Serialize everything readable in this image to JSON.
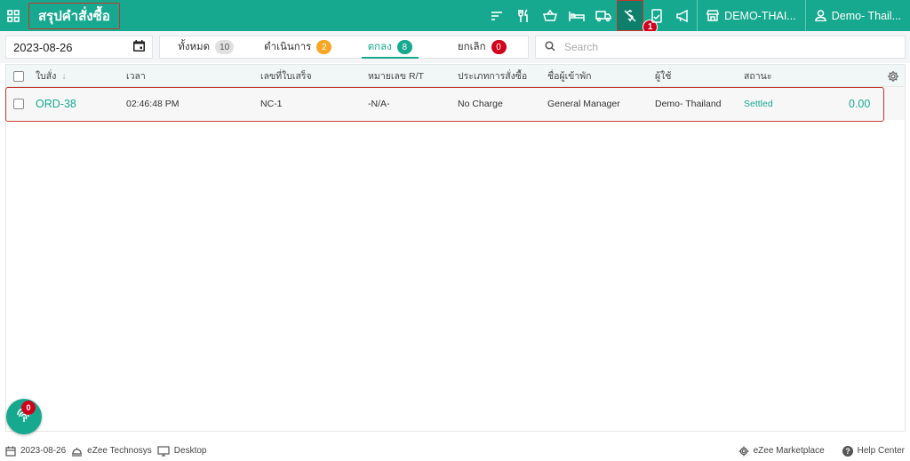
{
  "header": {
    "title": "สรุปคำสั่งซื้อ",
    "property": "DEMO-THAI...",
    "user": "Demo- Thail...",
    "notification_count": "1"
  },
  "filters": {
    "date": "2023-08-26",
    "search_placeholder": "Search",
    "tabs": [
      {
        "label": "ทั้งหมด",
        "count": "10"
      },
      {
        "label": "ดำเนินการ",
        "count": "2"
      },
      {
        "label": "ตกลง",
        "count": "8"
      },
      {
        "label": "ยกเลิก",
        "count": "0"
      }
    ]
  },
  "table": {
    "columns": [
      "ใบสั่ง",
      "เวลา",
      "เลขที่ใบเสร็จ",
      "หมายเลข R/T",
      "ประเภทการสั่งซื้อ",
      "ชื่อผู้เข้าพัก",
      "ผู้ใช้",
      "สถานะ"
    ],
    "rows": [
      {
        "order": "ORD-38",
        "time": "02:46:48 PM",
        "receipt": "NC-1",
        "room_table": "-N/A-",
        "order_type": "No Charge",
        "guest": "General Manager",
        "user": "Demo- Thailand",
        "status": "Settled",
        "amount": "0.00"
      }
    ]
  },
  "fab": {
    "count": "0"
  },
  "footer": {
    "date": "2023-08-26",
    "company": "eZee Technosys",
    "device": "Desktop",
    "marketplace": "eZee Marketplace",
    "help": "Help Center"
  },
  "colors": {
    "brand": "#17a98f",
    "brand_dark": "#0d7f6b",
    "alert": "#d0021b",
    "highlight_outline": "#c0392b"
  }
}
